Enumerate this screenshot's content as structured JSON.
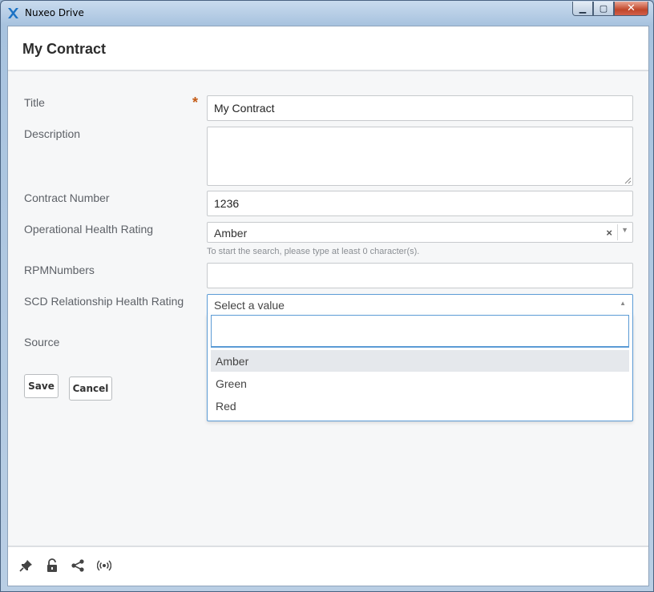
{
  "window": {
    "app_title": "Nuxeo Drive",
    "minimize_icon": "minimize-icon",
    "maximize_icon": "maximize-icon",
    "close_icon": "close-icon"
  },
  "header": {
    "title": "My Contract"
  },
  "form": {
    "title_label": "Title",
    "title_value": "My Contract",
    "required_mark": "*",
    "description_label": "Description",
    "description_value": "",
    "contract_number_label": "Contract Number",
    "contract_number_value": "1236",
    "operational_label": "Operational Health Rating",
    "operational_value": "Amber",
    "operational_clear": "×",
    "operational_hint": "To start the search, please type at least 0 character(s).",
    "rpm_label": "RPMNumbers",
    "rpm_value": "",
    "scd_label": "SCD Relationship Health Rating",
    "scd_placeholder": "Select a value",
    "scd_options": [
      "Amber",
      "Green",
      "Red"
    ],
    "scd_highlighted": "Amber",
    "source_label": "Source"
  },
  "actions": {
    "save_label": "Save",
    "cancel_label": "Cancel"
  },
  "footer": {
    "icons": [
      "pin-icon",
      "unlock-icon",
      "share-icon",
      "broadcast-icon"
    ]
  },
  "colors": {
    "accent": "#5b9bd5",
    "required": "#c45b16"
  }
}
